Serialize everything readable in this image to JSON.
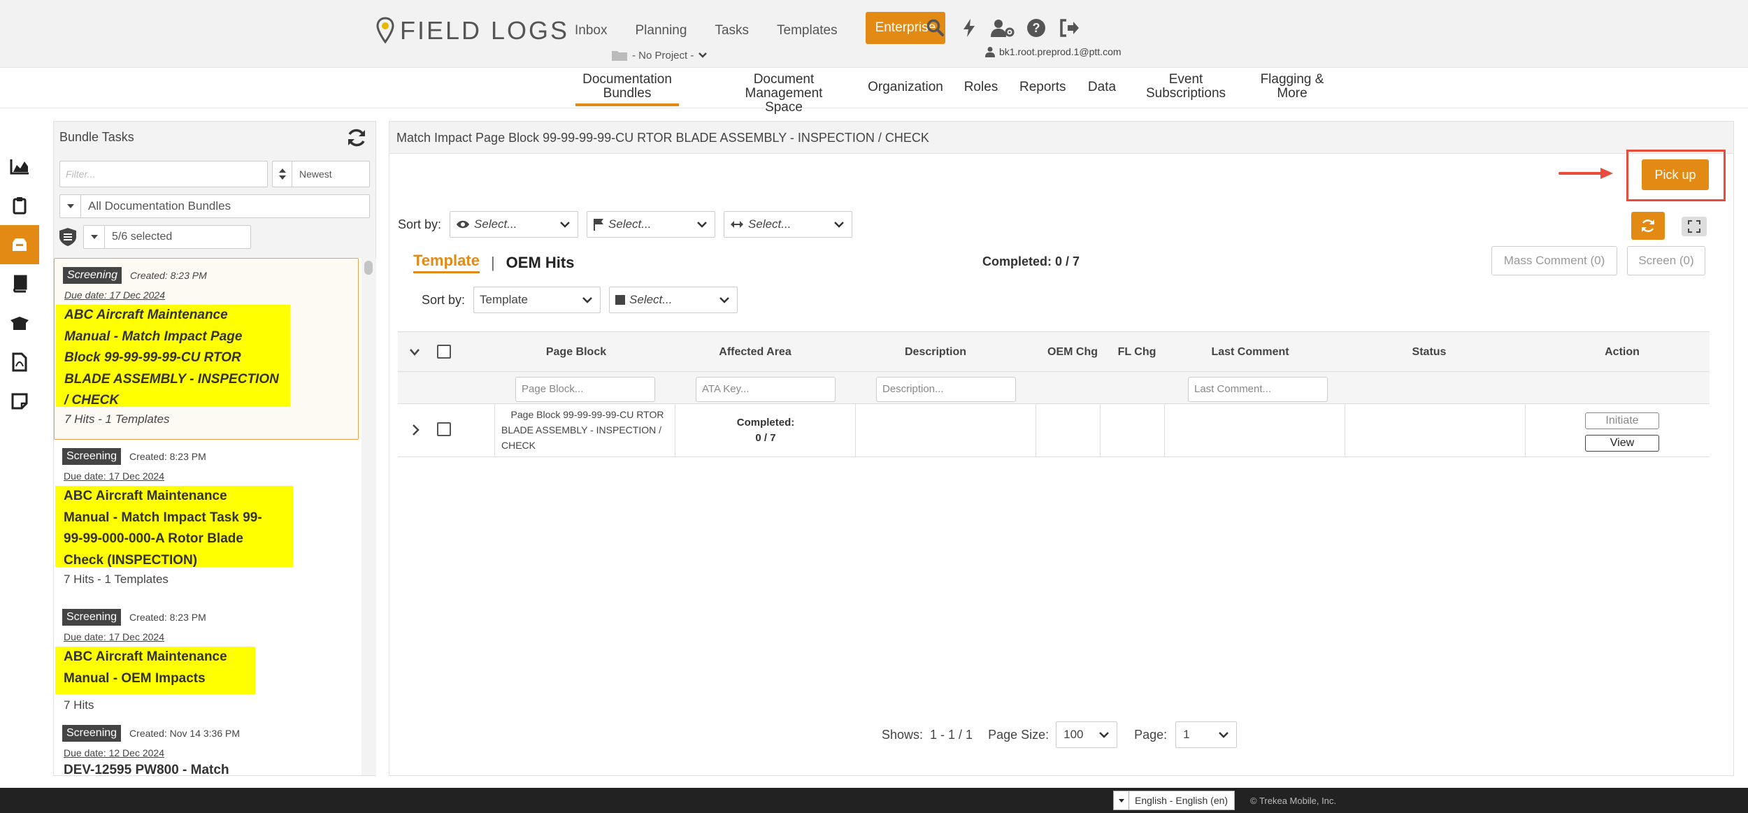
{
  "app": {
    "logo_text": "FIELD LOGS",
    "accent": "#e38a14"
  },
  "topnav": {
    "items": [
      {
        "label": "Inbox"
      },
      {
        "label": "Planning"
      },
      {
        "label": "Tasks"
      },
      {
        "label": "Templates"
      }
    ],
    "enterprise_label": "Enterprise",
    "project_label": "- No Project -",
    "user_email": "bk1.root.preprod.1@ptt.com",
    "icons": [
      "search-icon",
      "lightning-icon",
      "user-settings-icon",
      "help-icon",
      "logout-icon"
    ]
  },
  "subnav": {
    "items": [
      {
        "line1": "Documentation",
        "line2": "Bundles"
      },
      {
        "line1": "Document",
        "line2": "Management Space"
      },
      {
        "line1": "Organization",
        "line2": ""
      },
      {
        "line1": "Roles",
        "line2": ""
      },
      {
        "line1": "Reports",
        "line2": ""
      },
      {
        "line1": "Data",
        "line2": ""
      },
      {
        "line1": "Event",
        "line2": "Subscriptions"
      },
      {
        "line1": "Flagging &",
        "line2": "More"
      }
    ]
  },
  "left_panel": {
    "title": "Bundle Tasks",
    "filter_placeholder": "Filter...",
    "sort_value": "Newest",
    "bundle_filter": "All Documentation Bundles",
    "selected": "5/6 selected",
    "cards": [
      {
        "badge": "Screening",
        "created": "Created: 8:23 PM",
        "due": "Due date: 17 Dec 2024",
        "title_lines": [
          "ABC Aircraft Maintenance",
          "Manual - Match Impact Page",
          "Block 99-99-99-99-CU RTOR",
          "BLADE ASSEMBLY - INSPECTION",
          "/ CHECK"
        ],
        "hits": "7 Hits - 1 Templates"
      },
      {
        "badge": "Screening",
        "created": "Created: 8:23 PM",
        "due": "Due date: 17 Dec 2024",
        "title_lines": [
          "ABC Aircraft Maintenance",
          "Manual - Match Impact Task 99-",
          "99-99-000-000-A Rotor Blade",
          "Check (INSPECTION)"
        ],
        "hits": "7 Hits - 1 Templates"
      },
      {
        "badge": "Screening",
        "created": "Created: 8:23 PM",
        "due": "Due date: 17 Dec 2024",
        "title_lines": [
          "ABC Aircraft Maintenance",
          "Manual - OEM Impacts"
        ],
        "hits": "7 Hits"
      },
      {
        "badge": "Screening",
        "created": "Created: Nov 14 3:36 PM",
        "due": "Due date: 12 Dec 2024",
        "title_lines": [
          "DEV-12595 PW800 - Match"
        ],
        "hits": ""
      }
    ]
  },
  "right_panel": {
    "title": "Match Impact Page Block 99-99-99-99-CU RTOR BLADE ASSEMBLY - INSPECTION / CHECK",
    "pickup_label": "Pick up",
    "sortby_label": "Sort by:",
    "sort_selects": [
      "Select...",
      "Select...",
      "Select..."
    ],
    "tab_template": "Template",
    "tab_separator": "|",
    "tab_oem": "OEM Hits",
    "completed": "Completed: 0 / 7",
    "mass_comment": "Mass Comment (0)",
    "screen": "Screen (0)",
    "sortby2_label": "Sort by:",
    "sort2_value": "Template",
    "sort2_select": "Select...",
    "columns": [
      "Page Block",
      "Affected Area",
      "Description",
      "OEM Chg",
      "FL Chg",
      "Last Comment",
      "Status",
      "Action"
    ],
    "filters": {
      "page_block": "Page Block...",
      "ata_key": "ATA Key...",
      "description": "Description...",
      "last_comment": "Last Comment..."
    },
    "row": {
      "page_block_lines": [
        "Page Block 99-99-99-99-CU RTOR",
        "BLADE ASSEMBLY - INSPECTION /",
        "CHECK"
      ],
      "completed_label": "Completed:",
      "completed_value": "0 / 7",
      "initiate": "Initiate",
      "view": "View"
    },
    "pager": {
      "shows_label": "Shows:",
      "shows_value": "1 - 1 / 1",
      "page_size_label": "Page Size:",
      "page_size": "100",
      "page_label": "Page:",
      "page": "1"
    }
  },
  "footer": {
    "language": "English - English (en)",
    "copyright": "© Trekea Mobile, Inc."
  }
}
